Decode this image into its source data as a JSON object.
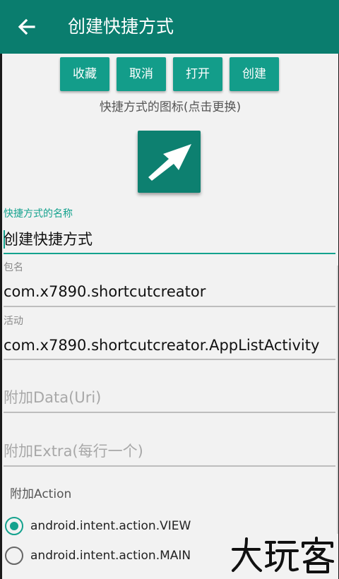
{
  "appbar": {
    "title": "创建快捷方式",
    "back_icon": "arrow-left-icon",
    "color": "#0a7d6e"
  },
  "actions": {
    "favorite": "收藏",
    "cancel": "取消",
    "open": "打开",
    "create": "创建",
    "accent": "#139d8a"
  },
  "icon_section": {
    "caption": "快捷方式的图标(点击更换)",
    "icon": "diagonal-arrow-icon"
  },
  "fields": {
    "name": {
      "label": "快捷方式的名称",
      "value": "创建快捷方式"
    },
    "package": {
      "label": "包名",
      "value": "com.x7890.shortcutcreator"
    },
    "activity": {
      "label": "活动",
      "value": "com.x7890.shortcutcreator.AppListActivity"
    },
    "data_uri": {
      "placeholder": "附加Data(Uri)"
    },
    "extra": {
      "placeholder": "附加Extra(每行一个)"
    }
  },
  "action_section": {
    "label": "附加Action",
    "options": [
      {
        "label": "android.intent.action.VIEW",
        "checked": true
      },
      {
        "label": "android.intent.action.MAIN",
        "checked": false
      }
    ]
  },
  "watermark": {
    "text": "大玩客"
  }
}
